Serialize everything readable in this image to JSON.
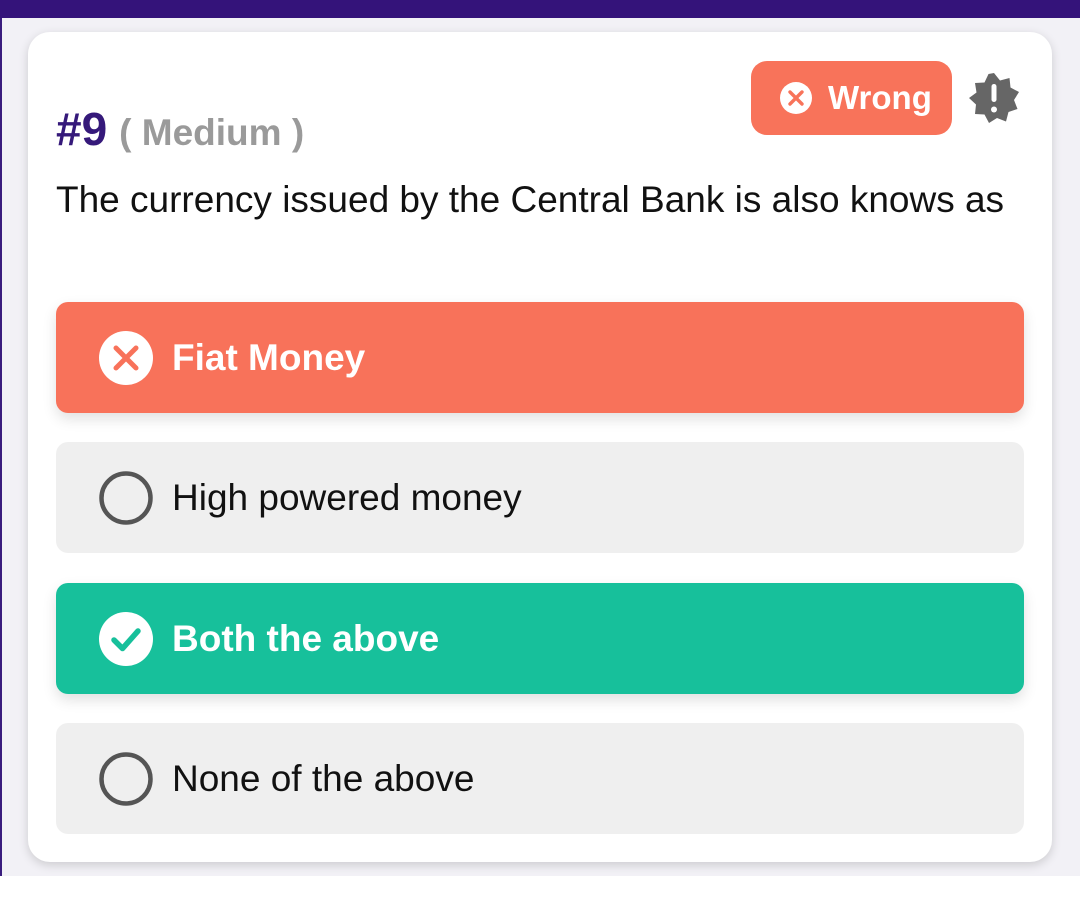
{
  "question": {
    "number": "#9",
    "difficulty": "( Medium )",
    "text": "The currency issued by the Central Bank is also knows as"
  },
  "result": {
    "label": "Wrong",
    "icon": "x-circle-icon",
    "color": "#f8735a"
  },
  "report_icon": "report-alert-icon",
  "options": [
    {
      "label": "Fiat Money",
      "state": "wrong",
      "icon": "x-circle-icon",
      "color": "#f8725a"
    },
    {
      "label": "High powered money",
      "state": "unselected",
      "icon": "radio-empty-icon",
      "color": "#efefef"
    },
    {
      "label": "Both the above",
      "state": "correct",
      "icon": "check-circle-icon",
      "color": "#17c09b"
    },
    {
      "label": "None of the above",
      "state": "unselected",
      "icon": "radio-empty-icon",
      "color": "#efefef"
    }
  ],
  "colors": {
    "header_bar": "#34137a",
    "question_number": "#35197a",
    "difficulty": "#9a9a9a"
  }
}
